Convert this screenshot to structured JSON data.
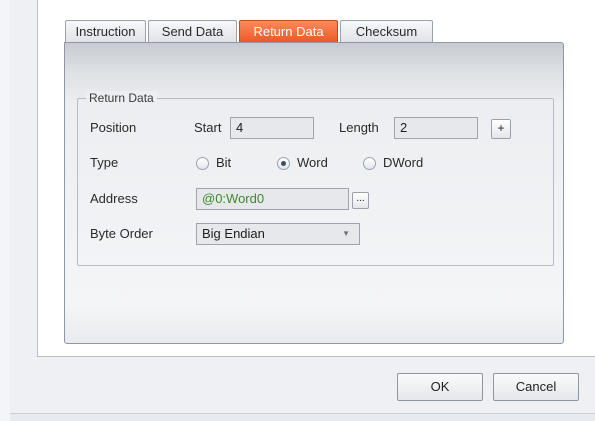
{
  "tabs": [
    {
      "label": "Instruction",
      "active": false
    },
    {
      "label": "Send Data",
      "active": false
    },
    {
      "label": "Return Data",
      "active": true
    },
    {
      "label": "Checksum",
      "active": false
    }
  ],
  "group": {
    "title": "Return Data",
    "position": {
      "label": "Position",
      "start_label": "Start",
      "start_value": "4",
      "length_label": "Length",
      "length_value": "2",
      "add_button": "+"
    },
    "type": {
      "label": "Type",
      "options": [
        {
          "label": "Bit",
          "checked": false
        },
        {
          "label": "Word",
          "checked": true
        },
        {
          "label": "DWord",
          "checked": false
        }
      ]
    },
    "address": {
      "label": "Address",
      "value": "@0:Word0",
      "value_color": "#3d8a2a",
      "browse_button": "..."
    },
    "byte_order": {
      "label": "Byte Order",
      "selected": "Big Endian"
    }
  },
  "buttons": {
    "ok": "OK",
    "cancel": "Cancel"
  },
  "colors": {
    "active_tab": "#ea5a2a",
    "address_text": "#3d8a2a"
  }
}
